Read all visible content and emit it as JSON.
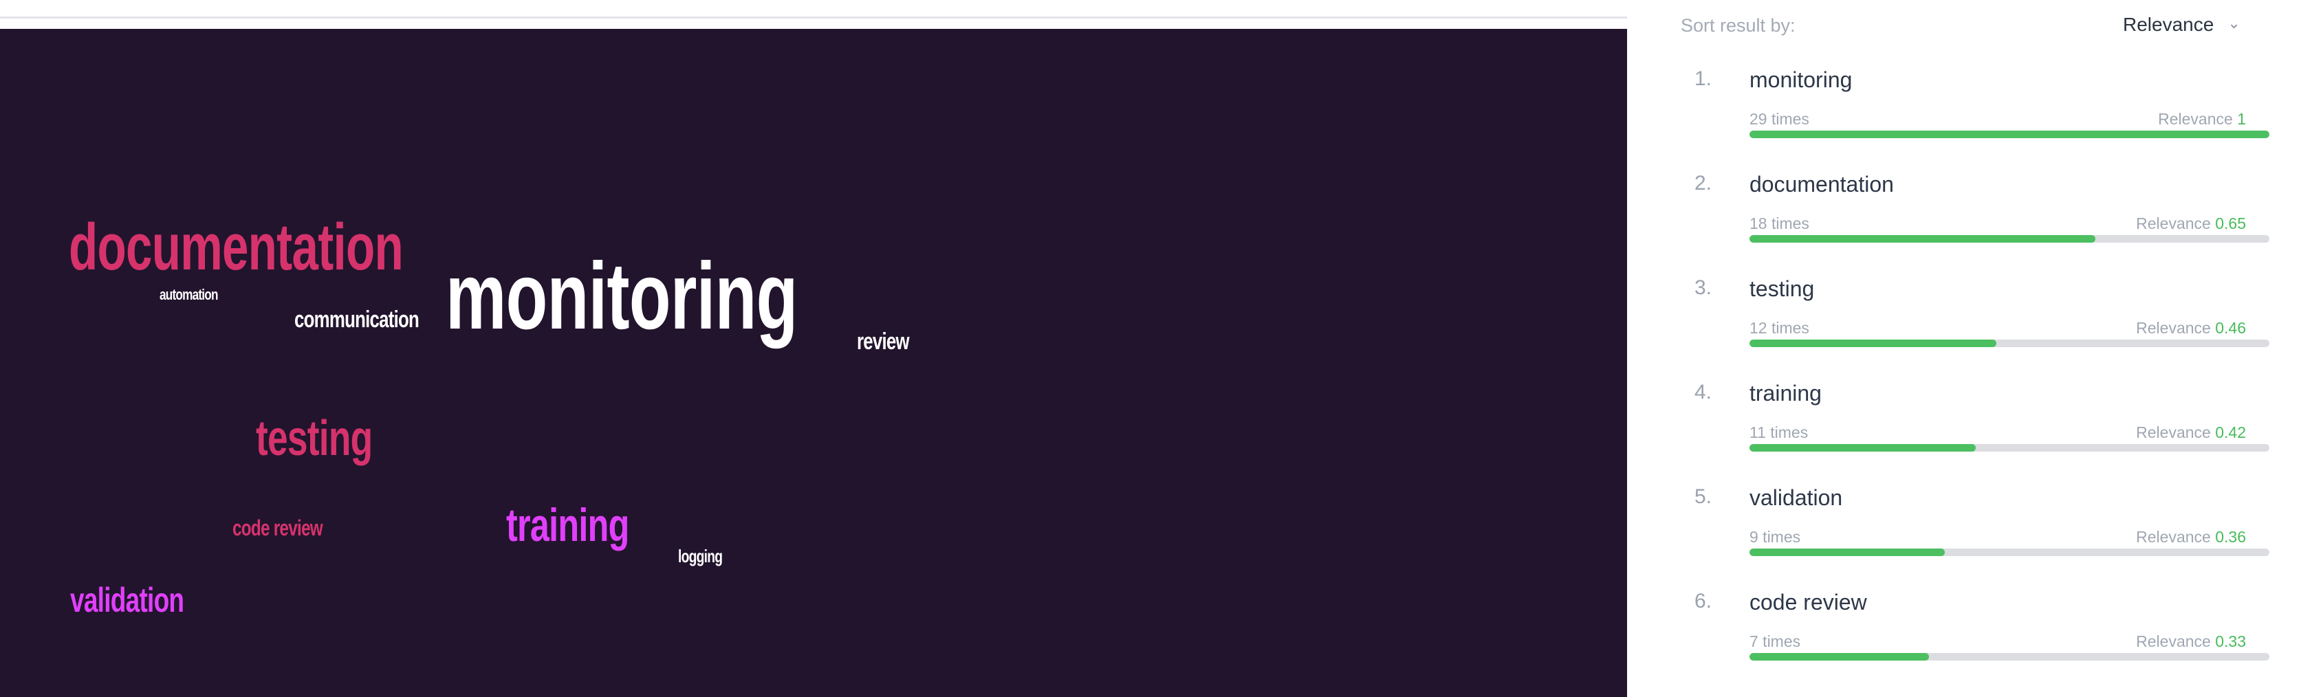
{
  "sort": {
    "label": "Sort result by:",
    "selected": "Relevance",
    "chevron_icon": "chevron-down-icon"
  },
  "word_cloud": [
    {
      "text": "documentation",
      "color": "#d6336c"
    },
    {
      "text": "automation",
      "color": "#ffffff"
    },
    {
      "text": "communication",
      "color": "#ffffff"
    },
    {
      "text": "monitoring",
      "color": "#ffffff"
    },
    {
      "text": "review",
      "color": "#ffffff"
    },
    {
      "text": "testing",
      "color": "#d6336c"
    },
    {
      "text": "code review",
      "color": "#d6336c"
    },
    {
      "text": "training",
      "color": "#e040fb"
    },
    {
      "text": "logging",
      "color": "#ffffff"
    },
    {
      "text": "validation",
      "color": "#e040fb"
    }
  ],
  "results": [
    {
      "index": "1.",
      "name": "monitoring",
      "count": "29 times",
      "relevance_label": "Relevance",
      "relevance": "1",
      "fraction": 1.0
    },
    {
      "index": "2.",
      "name": "documentation",
      "count": "18 times",
      "relevance_label": "Relevance",
      "relevance": "0.65",
      "fraction": 0.665
    },
    {
      "index": "3.",
      "name": "testing",
      "count": "12 times",
      "relevance_label": "Relevance",
      "relevance": "0.46",
      "fraction": 0.475
    },
    {
      "index": "4.",
      "name": "training",
      "count": "11 times",
      "relevance_label": "Relevance",
      "relevance": "0.42",
      "fraction": 0.435
    },
    {
      "index": "5.",
      "name": "validation",
      "count": "9 times",
      "relevance_label": "Relevance",
      "relevance": "0.36",
      "fraction": 0.375
    },
    {
      "index": "6.",
      "name": "code review",
      "count": "7 times",
      "relevance_label": "Relevance",
      "relevance": "0.33",
      "fraction": 0.345
    }
  ],
  "colors": {
    "cloud_background": "#22142d",
    "bar_fill": "#4cbf60",
    "bar_track": "#dcdde0",
    "accent_blue": "#3b82f6",
    "relevance_value": "#48bb5a"
  }
}
